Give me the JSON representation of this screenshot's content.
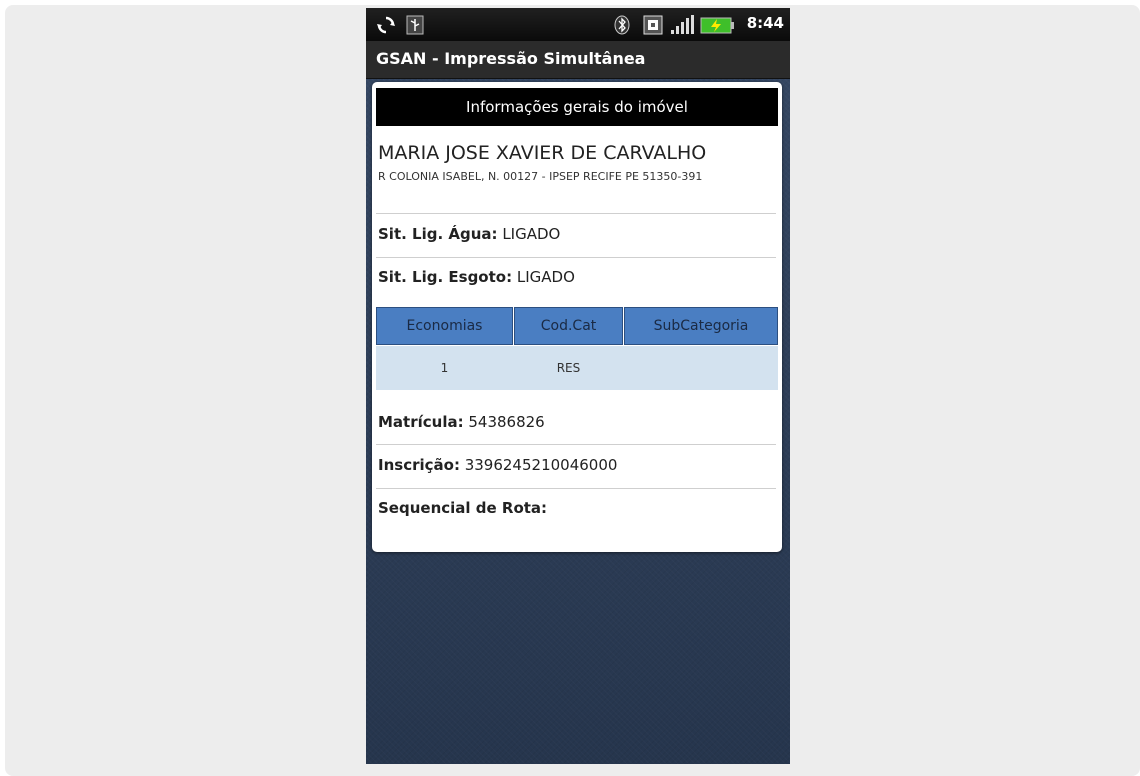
{
  "status_bar": {
    "time": "8:44",
    "icons": [
      "sync-icon",
      "usb-icon",
      "bluetooth-icon",
      "notification-icon",
      "signal-icon",
      "battery-icon"
    ]
  },
  "app": {
    "title": "GSAN - Impressão Simultânea"
  },
  "card": {
    "header": "Informações gerais do imóvel",
    "owner_name": "MARIA JOSE XAVIER DE CARVALHO",
    "address": "R COLONIA ISABEL, N. 00127 - IPSEP RECIFE PE 51350-391",
    "agua": {
      "label": "Sit. Lig. Água:",
      "value": "LIGADO"
    },
    "esgoto": {
      "label": "Sit. Lig. Esgoto:",
      "value": "LIGADO"
    },
    "table": {
      "headers": [
        "Economias",
        "Cod.Cat",
        "SubCategoria"
      ],
      "rows": [
        [
          "1",
          "RES",
          ""
        ]
      ]
    },
    "matricula": {
      "label": "Matrícula:",
      "value": "54386826"
    },
    "inscricao": {
      "label": "Inscrição:",
      "value": "3396245210046000"
    },
    "sequencial": {
      "label": "Sequencial de Rota:",
      "value": ""
    }
  },
  "colors": {
    "table_header": "#4a7ec2",
    "table_row": "#d3e2ef",
    "background": "#2e415e"
  }
}
